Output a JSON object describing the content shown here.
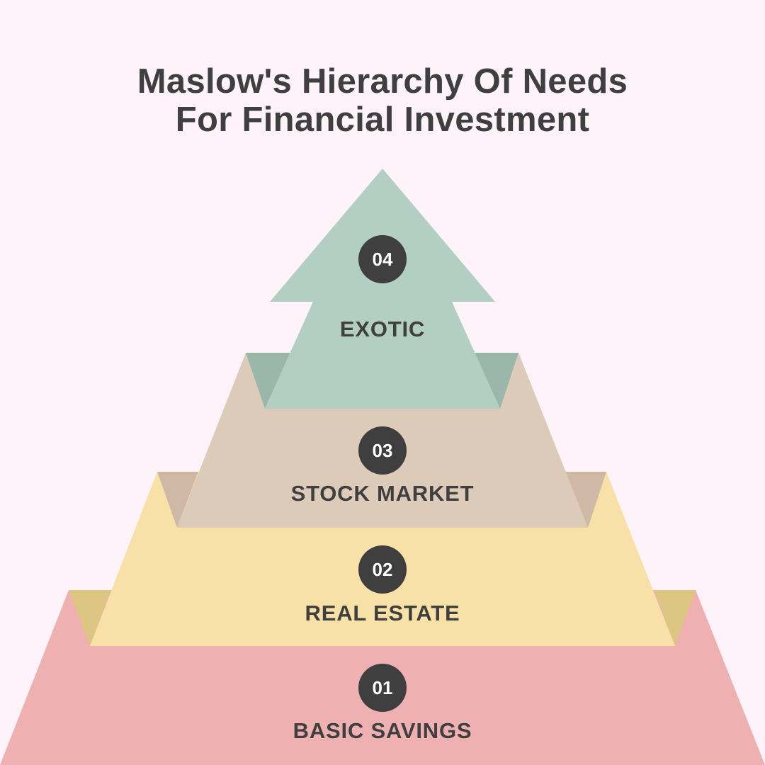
{
  "title": {
    "line1": "Maslow's Hierarchy Of Needs",
    "line2": "For Financial Investment"
  },
  "colors": {
    "background": "#fdf3f8",
    "text": "#3f3f3f",
    "badge": "#3f3f3f",
    "level1": "#efb0b1",
    "level2": "#f7e1a6",
    "level2_shade": "#ddc682",
    "level3": "#dccbb8",
    "level3_shade": "#cfb9a6",
    "level4": "#b3cfc4",
    "level4_shade": "#9bb7ac"
  },
  "levels": [
    {
      "number": "01",
      "label": "BASIC SAVINGS"
    },
    {
      "number": "02",
      "label": "REAL ESTATE"
    },
    {
      "number": "03",
      "label": "STOCK MARKET"
    },
    {
      "number": "04",
      "label": "EXOTIC"
    }
  ]
}
